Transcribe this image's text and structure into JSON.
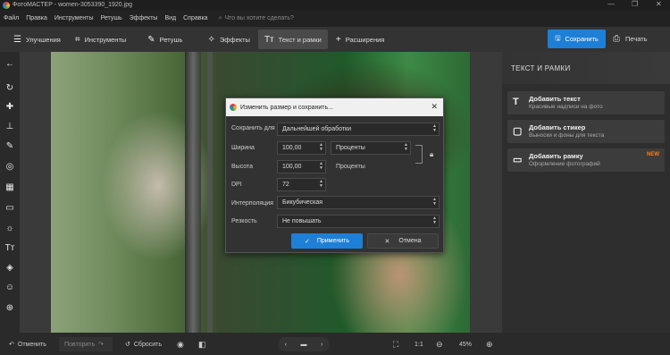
{
  "window": {
    "title": "ФотоМАСТЕР - women-3053390_1920.jpg",
    "min": "—",
    "max": "❐",
    "close": "✕"
  },
  "menu": {
    "items": [
      "Файл",
      "Правка",
      "Инструменты",
      "Ретушь",
      "Эффекты",
      "Вид",
      "Справка"
    ],
    "search_placeholder": "Что вы хотите сделать?"
  },
  "toolbar": {
    "tabs": [
      {
        "label": "Улучшения",
        "icon": "sliders-icon"
      },
      {
        "label": "Инструменты",
        "icon": "crop-icon"
      },
      {
        "label": "Ретушь",
        "icon": "brush-icon"
      },
      {
        "label": "Эффекты",
        "icon": "magic-wand-icon"
      },
      {
        "label": "Текст и рамки",
        "icon": "text-icon"
      },
      {
        "label": "Расширения",
        "icon": "plus-icon"
      }
    ],
    "active_tab": "Текст и рамки",
    "save_label": "Сохранить",
    "print_label": "Печать"
  },
  "right_panel": {
    "title": "ТЕКСТ И РАМКИ",
    "cards": [
      {
        "title": "Добавить текст",
        "subtitle": "Красивые надписи на фото",
        "icon": "text-icon",
        "badge": ""
      },
      {
        "title": "Добавить стикер",
        "subtitle": "Выноски и фоны для текста",
        "icon": "sticker-icon",
        "badge": ""
      },
      {
        "title": "Добавить рамку",
        "subtitle": "Оформление фотографий",
        "icon": "frame-icon",
        "badge": "NEW"
      }
    ]
  },
  "dialog": {
    "title": "Изменить размер и сохранить...",
    "save_for_label": "Сохранить для",
    "save_for_value": "Дальнейшей обработки",
    "width_label": "Ширина",
    "width_value": "100,00",
    "height_label": "Высота",
    "height_value": "100,00",
    "unit_value": "Проценты",
    "height_unit": "Проценты",
    "dpi_label": "DPI",
    "dpi_value": "72",
    "interp_label": "Интерполяция",
    "interp_value": "Бикубическая",
    "sharp_label": "Резкость",
    "sharp_value": "Не повышать",
    "apply_label": "Применить",
    "cancel_label": "Отмена"
  },
  "bottom": {
    "undo_label": "Отменить",
    "redo_label": "Повторить",
    "reset_label": "Сбросить",
    "zoom_fit": "1:1",
    "zoom_value": "45%"
  },
  "colors": {
    "accent": "#1e7fd6",
    "new_badge": "#ff7a1a"
  }
}
